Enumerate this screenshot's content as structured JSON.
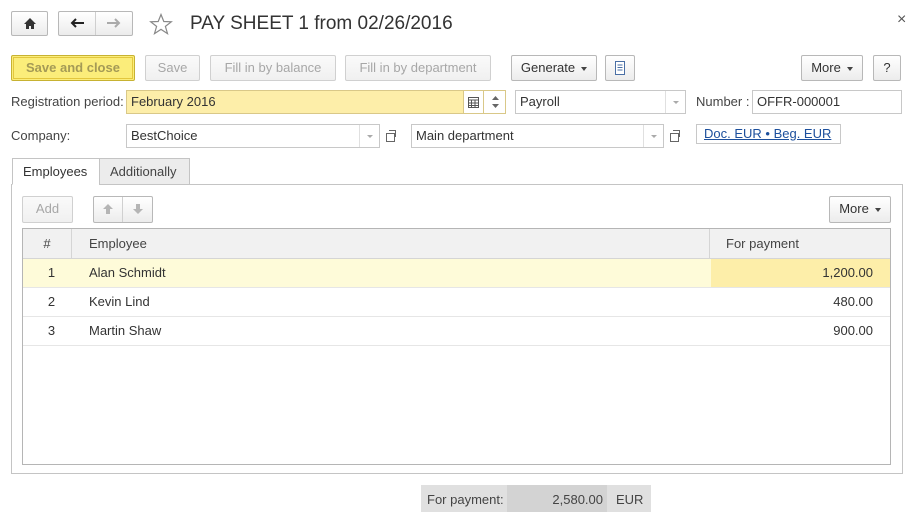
{
  "window": {
    "title": "PAY SHEET 1 from 02/26/2016",
    "close_glyph": "×"
  },
  "toolbar": {
    "save_and_close": "Save and close",
    "save": "Save",
    "fill_by_balance": "Fill in by balance",
    "fill_by_department": "Fill in by department",
    "generate": "Generate",
    "more": "More",
    "help": "?"
  },
  "form": {
    "registration_period_label": "Registration period:",
    "registration_period_value": "February 2016",
    "operation_value": "Payroll",
    "number_label": "Number :",
    "number_value": "OFFR-000001",
    "company_label": "Company:",
    "company_value": "BestChoice",
    "department_value": "Main department",
    "currency_link": "Doc. EUR • Beg. EUR"
  },
  "tabs": [
    {
      "label": "Employees",
      "active": true
    },
    {
      "label": "Additionally",
      "active": false
    }
  ],
  "table_toolbar": {
    "add": "Add",
    "more": "More"
  },
  "table": {
    "columns": [
      "#",
      "Employee",
      "For payment"
    ],
    "rows": [
      {
        "n": "1",
        "employee": "Alan Schmidt",
        "payment": "1,200.00"
      },
      {
        "n": "2",
        "employee": "Kevin Lind",
        "payment": "480.00"
      },
      {
        "n": "3",
        "employee": "Martin Shaw",
        "payment": "900.00"
      }
    ]
  },
  "footer": {
    "label": "For payment:",
    "total": "2,580.00",
    "currency": "EUR"
  },
  "colors": {
    "primary_button": "#fbed7a",
    "selected_row": "#fefbd9",
    "selected_cell": "#fdeea9",
    "link": "#1c4f9c"
  }
}
